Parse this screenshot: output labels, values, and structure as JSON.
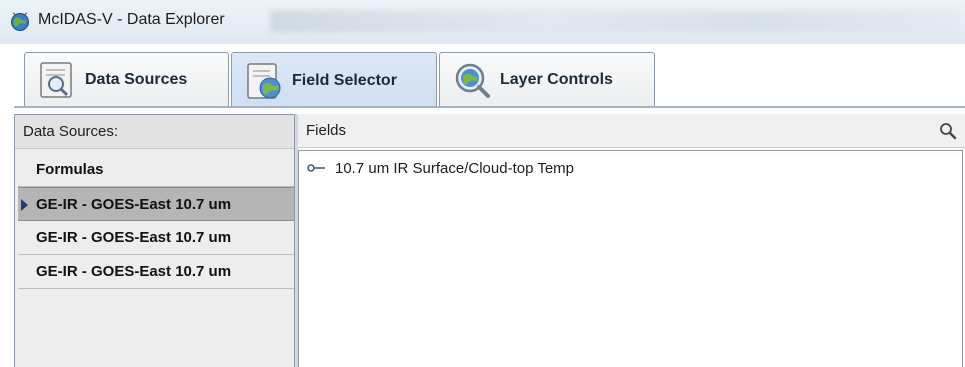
{
  "window": {
    "title": "McIDAS-V - Data Explorer",
    "icon": "mcidas-globe-icon"
  },
  "tabs": [
    {
      "label": "Data Sources",
      "icon": "magnifier-document-icon",
      "active": false
    },
    {
      "label": "Field Selector",
      "icon": "globe-document-icon",
      "active": true
    },
    {
      "label": "Layer Controls",
      "icon": "magnifier-globe-icon",
      "active": false
    }
  ],
  "data_sources_panel": {
    "header": "Data Sources:",
    "items": [
      {
        "label": "Formulas",
        "selected": false
      },
      {
        "label": "GE-IR - GOES-East 10.7 um",
        "selected": true
      },
      {
        "label": "GE-IR - GOES-East 10.7 um",
        "selected": false
      },
      {
        "label": "GE-IR - GOES-East 10.7 um",
        "selected": false
      }
    ]
  },
  "fields_panel": {
    "header": "Fields",
    "search_icon": "search-icon",
    "items": [
      {
        "label": "10.7 um IR Surface/Cloud-top Temp",
        "icon": "field-key-icon"
      }
    ]
  },
  "colors": {
    "active_tab": "#cfdff1",
    "selected_row": "#b5b5b5",
    "selection_arrow": "#1a3f73"
  }
}
